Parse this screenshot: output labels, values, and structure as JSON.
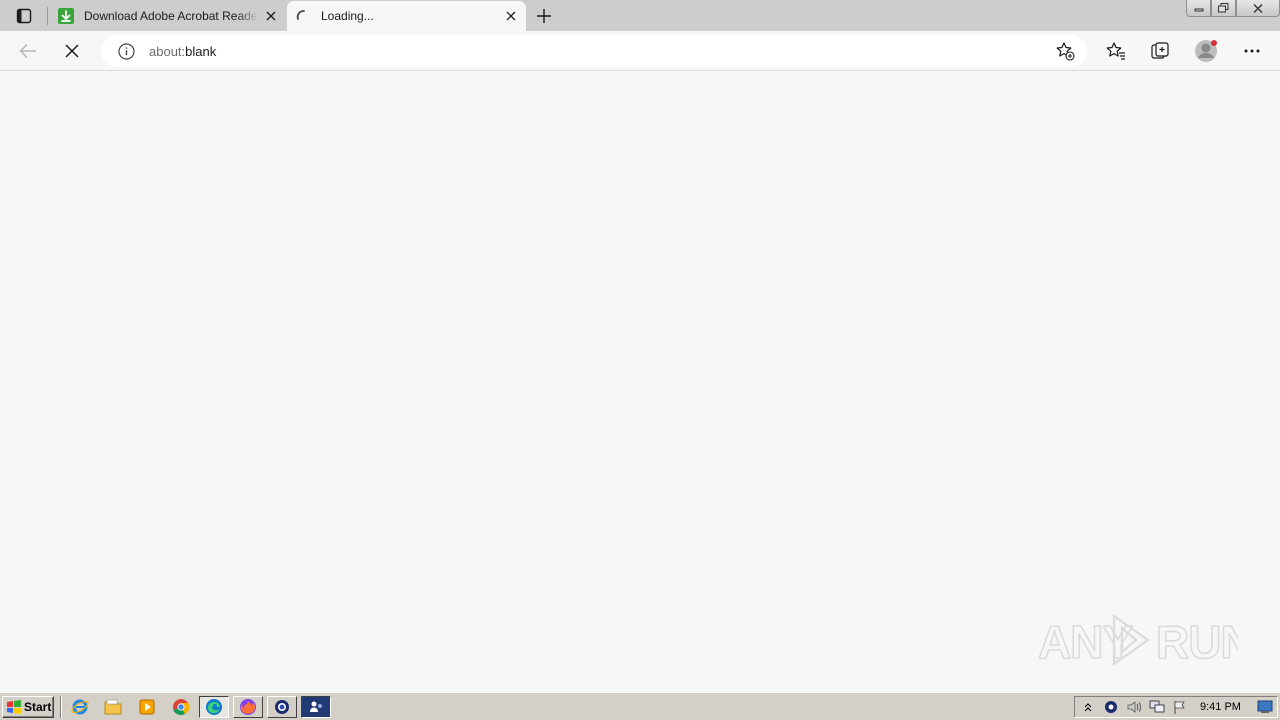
{
  "browser": {
    "tabs": [
      {
        "title": "Download Adobe Acrobat Reader",
        "favicon": "green-download-icon",
        "active": false
      },
      {
        "title": "Loading...",
        "favicon": "loading-spinner-icon",
        "active": true
      }
    ],
    "address": {
      "scheme": "about:",
      "rest": "blank"
    }
  },
  "watermark": {
    "text": "ANY RUN"
  },
  "taskbar": {
    "start_label": "Start",
    "clock": "9:41 PM"
  },
  "colors": {
    "tabstrip": "#cdcdcd",
    "content": "#f7f7f7",
    "accent_green": "#3aa53a",
    "profile_dot": "#d13438"
  }
}
